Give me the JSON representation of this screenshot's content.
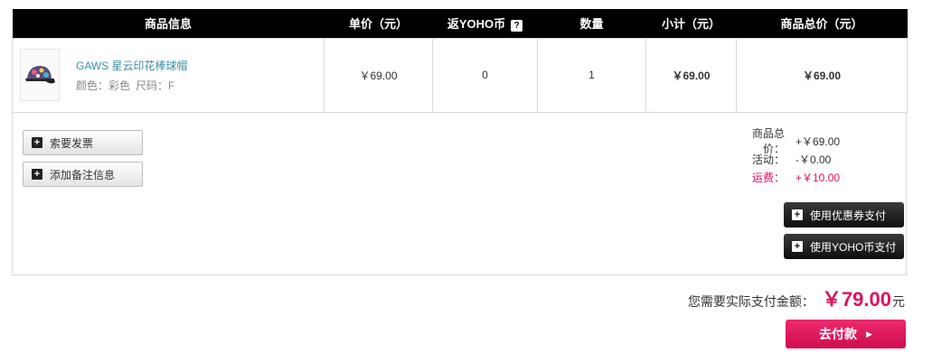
{
  "table": {
    "headers": {
      "product": "商品信息",
      "unit_price": "单价（元）",
      "yoho_coin": "返YOHO币",
      "quantity": "数量",
      "subtotal": "小计（元）",
      "item_total": "商品总价（元）"
    },
    "help_glyph": "?",
    "row": {
      "name": "GAWS 星云印花棒球帽",
      "color": "颜色：彩色",
      "size": "尺码：F",
      "unit_price": "￥69.00",
      "yoho_coin": "0",
      "quantity": "1",
      "subtotal": "￥69.00",
      "item_total": "￥69.00"
    }
  },
  "actions": {
    "invoice": "索要发票",
    "remark": "添加备注信息",
    "coupon": "使用优惠券支付",
    "coin": "使用YOHO币支付"
  },
  "summary": {
    "goods_label": "商品总价：",
    "goods_value": "+￥69.00",
    "promo_label": "活动：",
    "promo_value": "-￥0.00",
    "freight_label": "运费：",
    "freight_value": "+￥10.00"
  },
  "payment": {
    "label": "您需要实际支付金额：",
    "amount": "￥79.00",
    "unit": "元",
    "button": "去付款",
    "arrow": "▶"
  },
  "colors": {
    "accent": "#e0105f",
    "link": "#3a8fa6",
    "header_bg": "#000000"
  }
}
